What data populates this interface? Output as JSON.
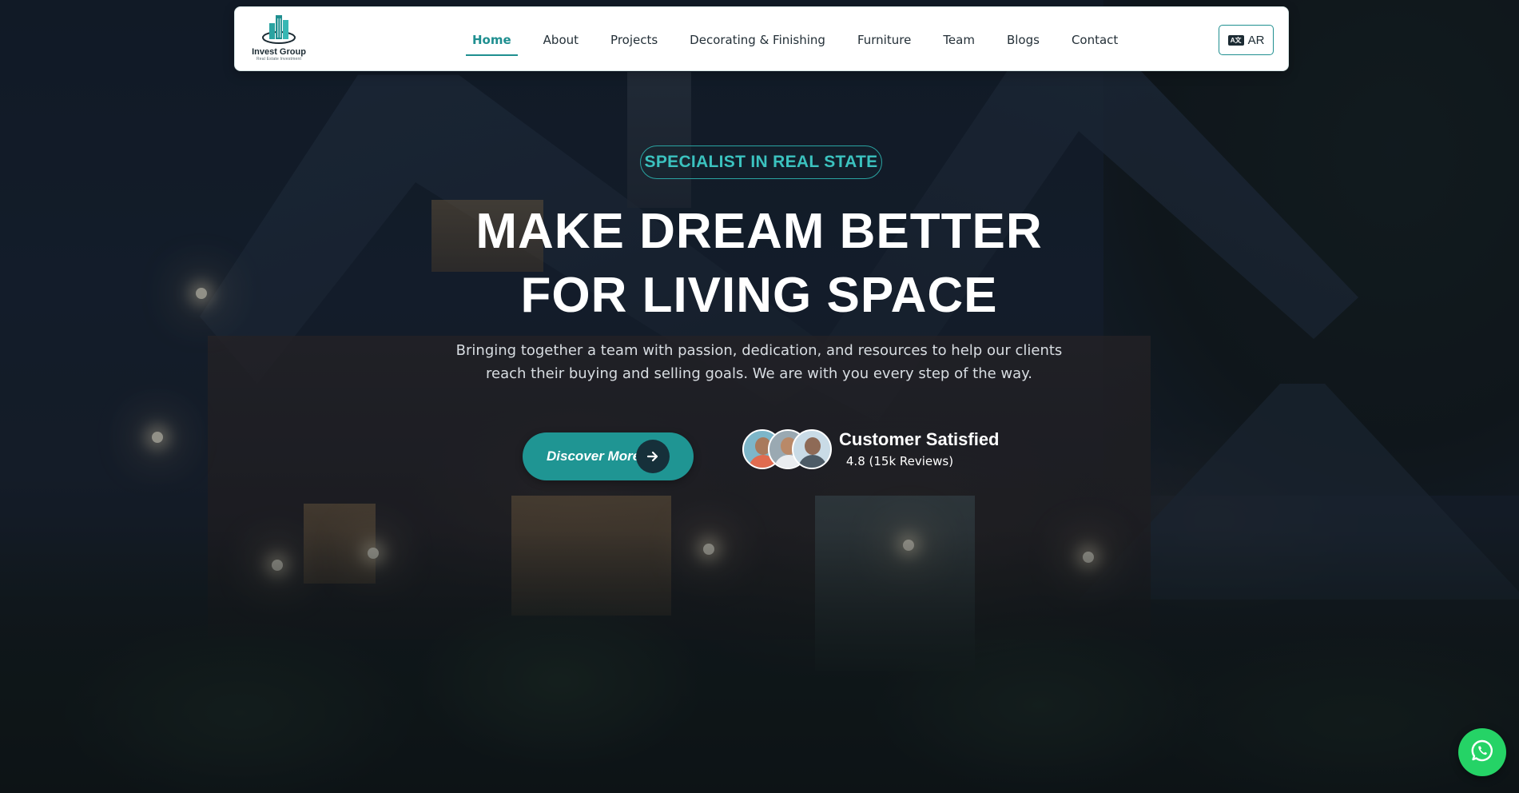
{
  "brand": {
    "name": "Invest Group",
    "tagline": "Real Estate Investment",
    "accent": "#1f8f90"
  },
  "nav": {
    "items": [
      {
        "label": "Home",
        "active": true
      },
      {
        "label": "About"
      },
      {
        "label": "Projects"
      },
      {
        "label": "Decorating & Finishing"
      },
      {
        "label": "Furniture"
      },
      {
        "label": "Team"
      },
      {
        "label": "Blogs"
      },
      {
        "label": "Contact"
      }
    ],
    "language_label": "AR",
    "language_icon": "language-icon"
  },
  "hero": {
    "badge": "SPECIALIST IN REAL STATE",
    "headline_line1": "MAKE DREAM BETTER",
    "headline_line2": "FOR LIVING SPACE",
    "subtitle": "Bringing together a team with passion, dedication, and resources to help our clients reach their buying and selling goals. We are with you every step of the way.",
    "cta_label": "Discover More",
    "cta_icon": "arrow-right-icon",
    "satisfaction_title": "Customer Satisfied",
    "satisfaction_reviews": "4.8 (15k Reviews)"
  },
  "floating": {
    "whatsapp_icon": "whatsapp-icon",
    "whatsapp_color": "#25d366"
  }
}
